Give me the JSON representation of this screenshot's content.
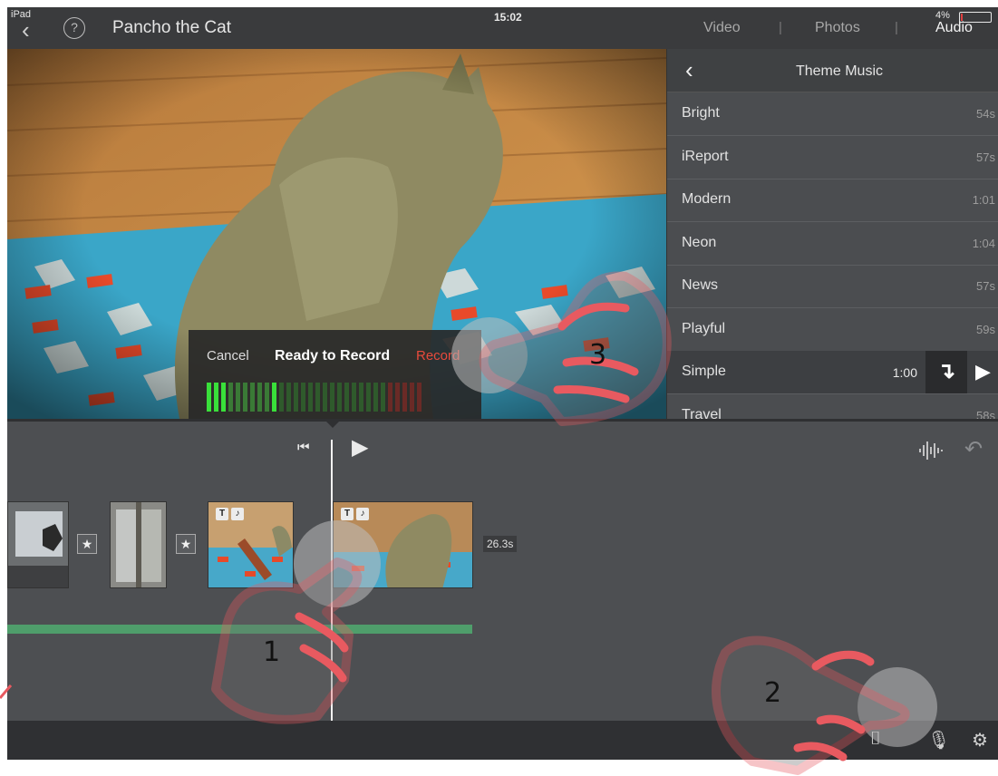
{
  "status_bar": {
    "device": "iPad",
    "time": "15:02",
    "battery": "4%"
  },
  "nav": {
    "back_icon": "chevron-left-icon",
    "help": "?",
    "project_title": "Pancho the Cat",
    "tabs": [
      {
        "label": "Video"
      },
      {
        "label": "Photos"
      },
      {
        "label": "Audio",
        "selected": true
      }
    ],
    "separator": "|"
  },
  "recorder": {
    "cancel": "Cancel",
    "status": "Ready to Record",
    "record": "Record",
    "level": 0.32
  },
  "theme_music": {
    "title": "Theme Music",
    "songs": [
      {
        "name": "Bright",
        "duration": "54s"
      },
      {
        "name": "iReport",
        "duration": "57s"
      },
      {
        "name": "Modern",
        "duration": "1:01"
      },
      {
        "name": "Neon",
        "duration": "1:04"
      },
      {
        "name": "News",
        "duration": "57s"
      },
      {
        "name": "Playful",
        "duration": "59s"
      },
      {
        "name": "Simple",
        "duration": "1:00",
        "selected": true
      },
      {
        "name": "Travel",
        "duration": "58s"
      }
    ],
    "use_icon": "↴",
    "play_icon": "▶"
  },
  "timeline": {
    "skip_back": "⏮",
    "play": "▶",
    "clip_duration": "26.3s",
    "transition_icon": "★",
    "title_badge": "T"
  },
  "toolbar": {
    "icons": [
      "camera-icon",
      "microphone-icon",
      "settings-icon"
    ]
  },
  "annotations": {
    "step1": "1",
    "step2": "2",
    "step3": "3"
  },
  "colors": {
    "audio_track": "#4f9e6b",
    "record_red": "#e84a3c",
    "hand_overlay": "#e85a60"
  }
}
